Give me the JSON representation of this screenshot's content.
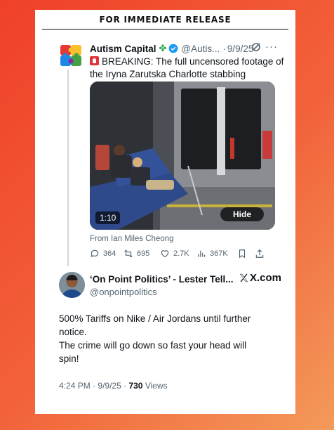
{
  "banner": {
    "text": "FOR IMMEDIATE RELEASE"
  },
  "tweet1": {
    "name": "Autism Capital",
    "handle": "@Autis...",
    "date": "9/9/25",
    "text": "BREAKING: The full uncensored footage of the Iryna Zarutska Charlotte stabbing",
    "video": {
      "duration": "1:10",
      "hide_label": "Hide"
    },
    "from_label": "From Ian Miles Cheong",
    "actions": {
      "replies": "364",
      "reposts": "695",
      "likes": "2.7K",
      "views": "367K"
    },
    "icons": [
      "reply-icon",
      "repost-icon",
      "like-icon",
      "views-icon",
      "bookmark-icon",
      "share-icon"
    ]
  },
  "tweet2": {
    "name": "‘On Point Politics’ - Lester Tell...",
    "handle": "@onpointpolitics",
    "source": "X.com",
    "text_lines": [
      "500% Tariffs on Nike / Air Jordans until further",
      "notice.",
      "The crime will go down so fast your head will",
      "spin!"
    ],
    "time": "4:24 PM",
    "date": "9/9/25",
    "views_count": "730",
    "views_label": "Views"
  },
  "colors": {
    "accent": "#1d9bf0",
    "background_gradient": [
      "#f0402a",
      "#f39a5a"
    ]
  }
}
